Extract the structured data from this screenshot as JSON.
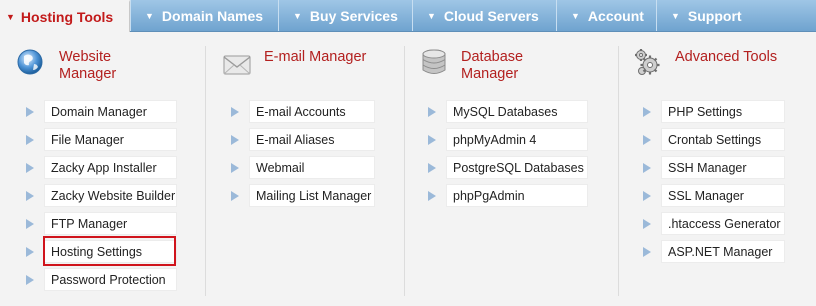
{
  "nav": {
    "tabs": [
      {
        "label": "Hosting Tools",
        "active": true
      },
      {
        "label": "Domain Names",
        "active": false
      },
      {
        "label": "Buy Services",
        "active": false
      },
      {
        "label": "Cloud Servers",
        "active": false
      },
      {
        "label": "Account",
        "active": false
      },
      {
        "label": "Support",
        "active": false
      }
    ]
  },
  "columns": [
    {
      "title_line1": "Website",
      "title_line2": "Manager",
      "icon": "globe-icon",
      "items": [
        "Domain Manager",
        "File Manager",
        "Zacky App Installer",
        "Zacky Website Builder",
        "FTP Manager",
        "Hosting Settings",
        "Password Protection"
      ]
    },
    {
      "title_line1": "E-mail Manager",
      "title_line2": "",
      "icon": "envelope-icon",
      "items": [
        "E-mail Accounts",
        "E-mail Aliases",
        "Webmail",
        "Mailing List Manager"
      ]
    },
    {
      "title_line1": "Database",
      "title_line2": "Manager",
      "icon": "database-icon",
      "items": [
        "MySQL Databases",
        "phpMyAdmin 4",
        "PostgreSQL Databases",
        "phpPgAdmin"
      ]
    },
    {
      "title_line1": "Advanced Tools",
      "title_line2": "",
      "icon": "gears-icon",
      "items": [
        "PHP Settings",
        "Crontab Settings",
        "SSH Manager",
        "SSL Manager",
        ".htaccess Generator",
        "ASP.NET Manager"
      ]
    }
  ],
  "highlighted_item": "Hosting Settings",
  "colors": {
    "accent": "#b3201f",
    "nav_bg": "#7fb0d8",
    "highlight_border": "#d0141c",
    "bullet": "#9bb9d9"
  }
}
